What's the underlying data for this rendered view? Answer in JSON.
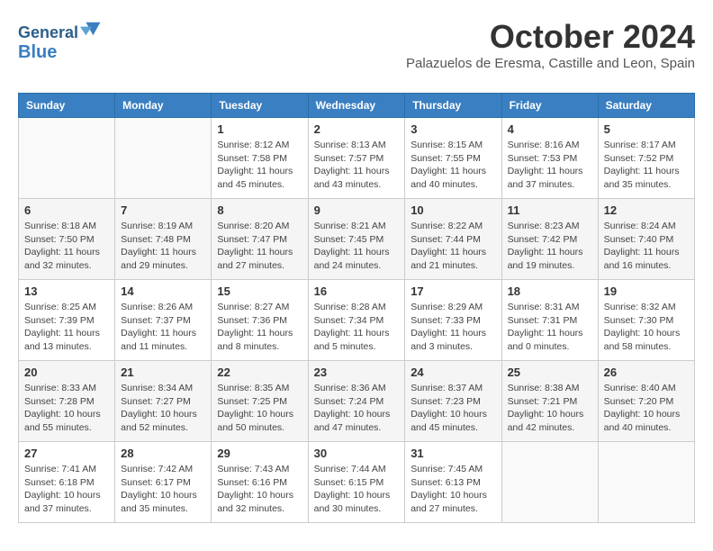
{
  "header": {
    "logo_line1": "General",
    "logo_line2": "Blue",
    "month_title": "October 2024",
    "subtitle": "Palazuelos de Eresma, Castille and Leon, Spain"
  },
  "weekdays": [
    "Sunday",
    "Monday",
    "Tuesday",
    "Wednesday",
    "Thursday",
    "Friday",
    "Saturday"
  ],
  "weeks": [
    [
      {
        "day": "",
        "sunrise": "",
        "sunset": "",
        "daylight": ""
      },
      {
        "day": "",
        "sunrise": "",
        "sunset": "",
        "daylight": ""
      },
      {
        "day": "1",
        "sunrise": "Sunrise: 8:12 AM",
        "sunset": "Sunset: 7:58 PM",
        "daylight": "Daylight: 11 hours and 45 minutes."
      },
      {
        "day": "2",
        "sunrise": "Sunrise: 8:13 AM",
        "sunset": "Sunset: 7:57 PM",
        "daylight": "Daylight: 11 hours and 43 minutes."
      },
      {
        "day": "3",
        "sunrise": "Sunrise: 8:15 AM",
        "sunset": "Sunset: 7:55 PM",
        "daylight": "Daylight: 11 hours and 40 minutes."
      },
      {
        "day": "4",
        "sunrise": "Sunrise: 8:16 AM",
        "sunset": "Sunset: 7:53 PM",
        "daylight": "Daylight: 11 hours and 37 minutes."
      },
      {
        "day": "5",
        "sunrise": "Sunrise: 8:17 AM",
        "sunset": "Sunset: 7:52 PM",
        "daylight": "Daylight: 11 hours and 35 minutes."
      }
    ],
    [
      {
        "day": "6",
        "sunrise": "Sunrise: 8:18 AM",
        "sunset": "Sunset: 7:50 PM",
        "daylight": "Daylight: 11 hours and 32 minutes."
      },
      {
        "day": "7",
        "sunrise": "Sunrise: 8:19 AM",
        "sunset": "Sunset: 7:48 PM",
        "daylight": "Daylight: 11 hours and 29 minutes."
      },
      {
        "day": "8",
        "sunrise": "Sunrise: 8:20 AM",
        "sunset": "Sunset: 7:47 PM",
        "daylight": "Daylight: 11 hours and 27 minutes."
      },
      {
        "day": "9",
        "sunrise": "Sunrise: 8:21 AM",
        "sunset": "Sunset: 7:45 PM",
        "daylight": "Daylight: 11 hours and 24 minutes."
      },
      {
        "day": "10",
        "sunrise": "Sunrise: 8:22 AM",
        "sunset": "Sunset: 7:44 PM",
        "daylight": "Daylight: 11 hours and 21 minutes."
      },
      {
        "day": "11",
        "sunrise": "Sunrise: 8:23 AM",
        "sunset": "Sunset: 7:42 PM",
        "daylight": "Daylight: 11 hours and 19 minutes."
      },
      {
        "day": "12",
        "sunrise": "Sunrise: 8:24 AM",
        "sunset": "Sunset: 7:40 PM",
        "daylight": "Daylight: 11 hours and 16 minutes."
      }
    ],
    [
      {
        "day": "13",
        "sunrise": "Sunrise: 8:25 AM",
        "sunset": "Sunset: 7:39 PM",
        "daylight": "Daylight: 11 hours and 13 minutes."
      },
      {
        "day": "14",
        "sunrise": "Sunrise: 8:26 AM",
        "sunset": "Sunset: 7:37 PM",
        "daylight": "Daylight: 11 hours and 11 minutes."
      },
      {
        "day": "15",
        "sunrise": "Sunrise: 8:27 AM",
        "sunset": "Sunset: 7:36 PM",
        "daylight": "Daylight: 11 hours and 8 minutes."
      },
      {
        "day": "16",
        "sunrise": "Sunrise: 8:28 AM",
        "sunset": "Sunset: 7:34 PM",
        "daylight": "Daylight: 11 hours and 5 minutes."
      },
      {
        "day": "17",
        "sunrise": "Sunrise: 8:29 AM",
        "sunset": "Sunset: 7:33 PM",
        "daylight": "Daylight: 11 hours and 3 minutes."
      },
      {
        "day": "18",
        "sunrise": "Sunrise: 8:31 AM",
        "sunset": "Sunset: 7:31 PM",
        "daylight": "Daylight: 11 hours and 0 minutes."
      },
      {
        "day": "19",
        "sunrise": "Sunrise: 8:32 AM",
        "sunset": "Sunset: 7:30 PM",
        "daylight": "Daylight: 10 hours and 58 minutes."
      }
    ],
    [
      {
        "day": "20",
        "sunrise": "Sunrise: 8:33 AM",
        "sunset": "Sunset: 7:28 PM",
        "daylight": "Daylight: 10 hours and 55 minutes."
      },
      {
        "day": "21",
        "sunrise": "Sunrise: 8:34 AM",
        "sunset": "Sunset: 7:27 PM",
        "daylight": "Daylight: 10 hours and 52 minutes."
      },
      {
        "day": "22",
        "sunrise": "Sunrise: 8:35 AM",
        "sunset": "Sunset: 7:25 PM",
        "daylight": "Daylight: 10 hours and 50 minutes."
      },
      {
        "day": "23",
        "sunrise": "Sunrise: 8:36 AM",
        "sunset": "Sunset: 7:24 PM",
        "daylight": "Daylight: 10 hours and 47 minutes."
      },
      {
        "day": "24",
        "sunrise": "Sunrise: 8:37 AM",
        "sunset": "Sunset: 7:23 PM",
        "daylight": "Daylight: 10 hours and 45 minutes."
      },
      {
        "day": "25",
        "sunrise": "Sunrise: 8:38 AM",
        "sunset": "Sunset: 7:21 PM",
        "daylight": "Daylight: 10 hours and 42 minutes."
      },
      {
        "day": "26",
        "sunrise": "Sunrise: 8:40 AM",
        "sunset": "Sunset: 7:20 PM",
        "daylight": "Daylight: 10 hours and 40 minutes."
      }
    ],
    [
      {
        "day": "27",
        "sunrise": "Sunrise: 7:41 AM",
        "sunset": "Sunset: 6:18 PM",
        "daylight": "Daylight: 10 hours and 37 minutes."
      },
      {
        "day": "28",
        "sunrise": "Sunrise: 7:42 AM",
        "sunset": "Sunset: 6:17 PM",
        "daylight": "Daylight: 10 hours and 35 minutes."
      },
      {
        "day": "29",
        "sunrise": "Sunrise: 7:43 AM",
        "sunset": "Sunset: 6:16 PM",
        "daylight": "Daylight: 10 hours and 32 minutes."
      },
      {
        "day": "30",
        "sunrise": "Sunrise: 7:44 AM",
        "sunset": "Sunset: 6:15 PM",
        "daylight": "Daylight: 10 hours and 30 minutes."
      },
      {
        "day": "31",
        "sunrise": "Sunrise: 7:45 AM",
        "sunset": "Sunset: 6:13 PM",
        "daylight": "Daylight: 10 hours and 27 minutes."
      },
      {
        "day": "",
        "sunrise": "",
        "sunset": "",
        "daylight": ""
      },
      {
        "day": "",
        "sunrise": "",
        "sunset": "",
        "daylight": ""
      }
    ]
  ]
}
